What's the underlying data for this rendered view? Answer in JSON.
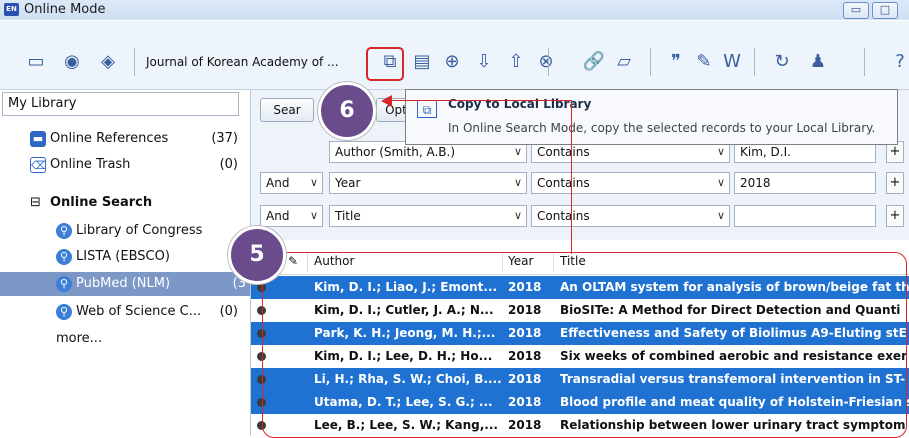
{
  "window": {
    "app_icon_text": "EN",
    "title": "Online Mode",
    "minimize_glyph": "▭",
    "maximize_glyph": "□"
  },
  "toolbar": {
    "library_select": "Journal of Korean Academy of ...",
    "icons": [
      "folder-icon",
      "globe-icon",
      "sync-icon",
      "copy-to-local-icon",
      "add-reference-icon",
      "online-search-icon",
      "download-icon",
      "upload-icon",
      "find-fulltext-icon",
      "link-icon",
      "open-folder-icon",
      "quote-icon",
      "edit-icon",
      "word-icon",
      "refresh-icon",
      "add-user-icon",
      "help-icon"
    ],
    "icon_glyphs": [
      "▭",
      "◉",
      "◈",
      "⧉",
      "▤",
      "⊕",
      "⇩",
      "⇧",
      "⊗",
      "🔗",
      "▱",
      "❞",
      "✎",
      "W",
      "↻",
      "♟",
      "?"
    ]
  },
  "tooltip": {
    "title": "Copy to Local Library",
    "description": "In Online Search Mode, copy the selected records to your Local Library.",
    "icon_glyph": "⧉"
  },
  "sidebar": {
    "header": "My Library",
    "items": [
      {
        "label": "Online References",
        "count": "(37)",
        "icon": "folder-icon"
      },
      {
        "label": "Online Trash",
        "count": "(0)",
        "icon": "trash-icon"
      }
    ],
    "online_search_label": "Online Search",
    "online_search_toggle": "⊟",
    "databases": [
      {
        "label": "Library of Congress",
        "count": ""
      },
      {
        "label": "LISTA (EBSCO)",
        "count": ""
      },
      {
        "label": "PubMed (NLM)",
        "count": "(3"
      },
      {
        "label": "Web of Science C...",
        "count": "(0)"
      }
    ],
    "more_label": "more..."
  },
  "search": {
    "search_button": "Sear",
    "options_button": "Opt",
    "rows": [
      {
        "bool": "",
        "field": "Author (Smith, A.B.)",
        "op": "Contains",
        "value": "Kim, D.I."
      },
      {
        "bool": "And",
        "field": "Year",
        "op": "Contains",
        "value": "2018"
      },
      {
        "bool": "And",
        "field": "Title",
        "op": "Contains",
        "value": ""
      }
    ],
    "plus": "+"
  },
  "table": {
    "columns": {
      "author": "Author",
      "year": "Year",
      "title": "Title"
    },
    "rows": [
      {
        "author": "Kim, D. I.; Liao, J.; Emont...",
        "year": "2018",
        "title": "An OLTAM system for analysis of brown/beige fat th",
        "selected": true
      },
      {
        "author": "Kim, D. I.; Cutler, J. A.; N...",
        "year": "2018",
        "title": "BioSITe: A Method for Direct Detection and Quanti",
        "selected": false
      },
      {
        "author": "Park, K. H.; Jeong, M. H.;...",
        "year": "2018",
        "title": "Effectiveness and Safety of Biolimus A9-Eluting stE",
        "selected": true
      },
      {
        "author": "Kim, D. I.; Lee, D. H.; Ho...",
        "year": "2018",
        "title": "Six weeks of combined aerobic and resistance exer",
        "selected": false
      },
      {
        "author": "Li, H.; Rha, S. W.; Choi, B....",
        "year": "2018",
        "title": "Transradial versus transfemoral intervention in ST-",
        "selected": true
      },
      {
        "author": "Utama, D. T.; Lee, S. G.; ...",
        "year": "2018",
        "title": "Blood profile and meat quality of Holstein-Friesian s",
        "selected": true
      },
      {
        "author": "Lee, B.; Lee, S. W.; Kang,...",
        "year": "2018",
        "title": "Relationship between lower urinary tract symptom",
        "selected": false
      }
    ]
  },
  "annotations": {
    "badge_6": "6",
    "badge_5": "5"
  },
  "colors": {
    "selection": "#1f72d1",
    "annotation_red": "#d8262a",
    "badge_purple": "#6a4b8c",
    "sidebar_selected": "#7d97c6"
  }
}
